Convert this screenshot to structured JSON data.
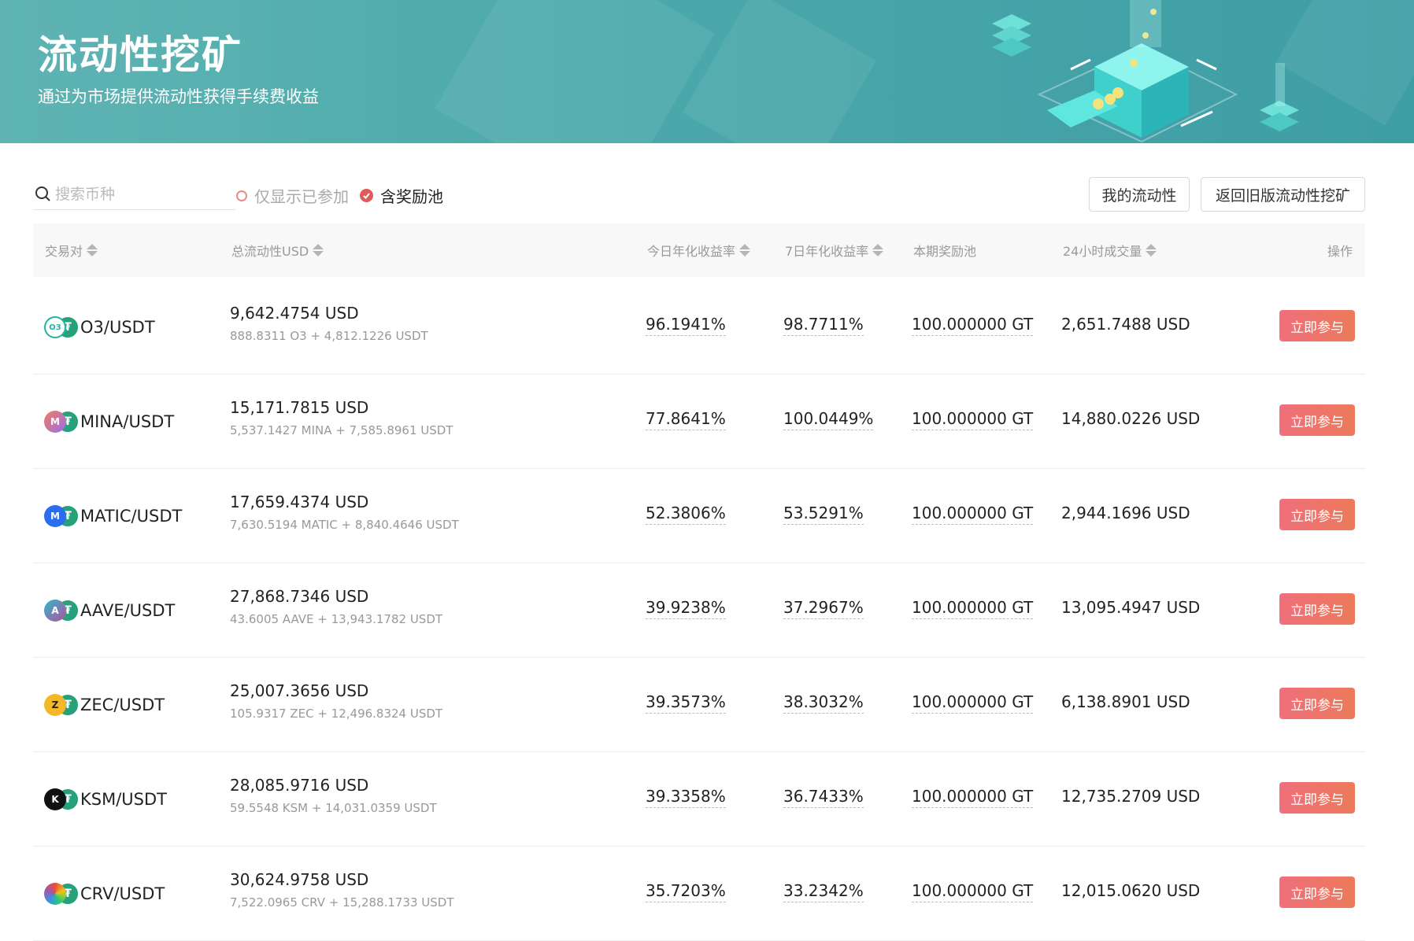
{
  "banner": {
    "title": "流动性挖矿",
    "subtitle": "通过为市场提供流动性获得手续费收益"
  },
  "toolbar": {
    "search_placeholder": "搜索币种",
    "filter_joined_label": "仅显示已参加",
    "filter_reward_label": "含奖励池",
    "my_liquidity_label": "我的流动性",
    "old_version_label": "返回旧版流动性挖矿"
  },
  "table": {
    "headers": {
      "pair": "交易对",
      "liquidity": "总流动性USD",
      "today_apy": "今日年化收益率",
      "week_apy": "7日年化收益率",
      "reward_pool": "本期奖励池",
      "volume": "24小时成交量",
      "action": "操作"
    },
    "join_label": "立即参与",
    "rows": [
      {
        "coin": "O3",
        "pair": "O3/USDT",
        "liquidity": "9,642.4754 USD",
        "liquidity_detail": "888.8311 O3 + 4,812.1226 USDT",
        "today_apy": "96.1941%",
        "week_apy": "98.7711%",
        "reward": "100.000000 GT",
        "volume": "2,651.7488 USD"
      },
      {
        "coin": "MINA",
        "pair": "MINA/USDT",
        "liquidity": "15,171.7815 USD",
        "liquidity_detail": "5,537.1427 MINA + 7,585.8961 USDT",
        "today_apy": "77.8641%",
        "week_apy": "100.0449%",
        "reward": "100.000000 GT",
        "volume": "14,880.0226 USD"
      },
      {
        "coin": "MATIC",
        "pair": "MATIC/USDT",
        "liquidity": "17,659.4374 USD",
        "liquidity_detail": "7,630.5194 MATIC + 8,840.4646 USDT",
        "today_apy": "52.3806%",
        "week_apy": "53.5291%",
        "reward": "100.000000 GT",
        "volume": "2,944.1696 USD"
      },
      {
        "coin": "AAVE",
        "pair": "AAVE/USDT",
        "liquidity": "27,868.7346 USD",
        "liquidity_detail": "43.6005 AAVE + 13,943.1782 USDT",
        "today_apy": "39.9238%",
        "week_apy": "37.2967%",
        "reward": "100.000000 GT",
        "volume": "13,095.4947 USD"
      },
      {
        "coin": "ZEC",
        "pair": "ZEC/USDT",
        "liquidity": "25,007.3656 USD",
        "liquidity_detail": "105.9317 ZEC + 12,496.8324 USDT",
        "today_apy": "39.3573%",
        "week_apy": "38.3032%",
        "reward": "100.000000 GT",
        "volume": "6,138.8901 USD"
      },
      {
        "coin": "KSM",
        "pair": "KSM/USDT",
        "liquidity": "28,085.9716 USD",
        "liquidity_detail": "59.5548 KSM + 14,031.0359 USDT",
        "today_apy": "39.3358%",
        "week_apy": "36.7433%",
        "reward": "100.000000 GT",
        "volume": "12,735.2709 USD"
      },
      {
        "coin": "CRV",
        "pair": "CRV/USDT",
        "liquidity": "30,624.9758 USD",
        "liquidity_detail": "7,522.0965 CRV + 15,288.1733 USDT",
        "today_apy": "35.7203%",
        "week_apy": "33.2342%",
        "reward": "100.000000 GT",
        "volume": "12,015.0620 USD"
      }
    ]
  },
  "colors": {
    "accent": "#e05a5a",
    "join_button": "#ee7468",
    "banner": "#4ba8aa"
  }
}
